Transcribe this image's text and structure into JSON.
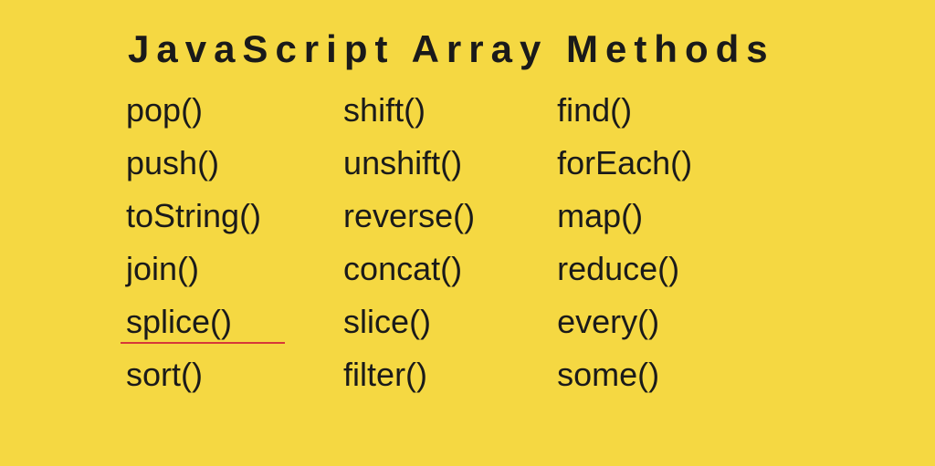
{
  "title": "JavaScript Array Methods",
  "columns": [
    {
      "items": [
        {
          "label": "pop()",
          "underline": false
        },
        {
          "label": "push()",
          "underline": false
        },
        {
          "label": "toString()",
          "underline": false
        },
        {
          "label": "join()",
          "underline": false
        },
        {
          "label": "splice()",
          "underline": true
        },
        {
          "label": "sort()",
          "underline": false
        }
      ]
    },
    {
      "items": [
        {
          "label": "shift()",
          "underline": false
        },
        {
          "label": "unshift()",
          "underline": false
        },
        {
          "label": "reverse()",
          "underline": false
        },
        {
          "label": "concat()",
          "underline": false
        },
        {
          "label": "slice()",
          "underline": false
        },
        {
          "label": "filter()",
          "underline": false
        }
      ]
    },
    {
      "items": [
        {
          "label": "find()",
          "underline": false
        },
        {
          "label": "forEach()",
          "underline": false
        },
        {
          "label": "map()",
          "underline": false
        },
        {
          "label": "reduce()",
          "underline": false
        },
        {
          "label": "every()",
          "underline": false
        },
        {
          "label": "some()",
          "underline": false
        }
      ]
    }
  ]
}
